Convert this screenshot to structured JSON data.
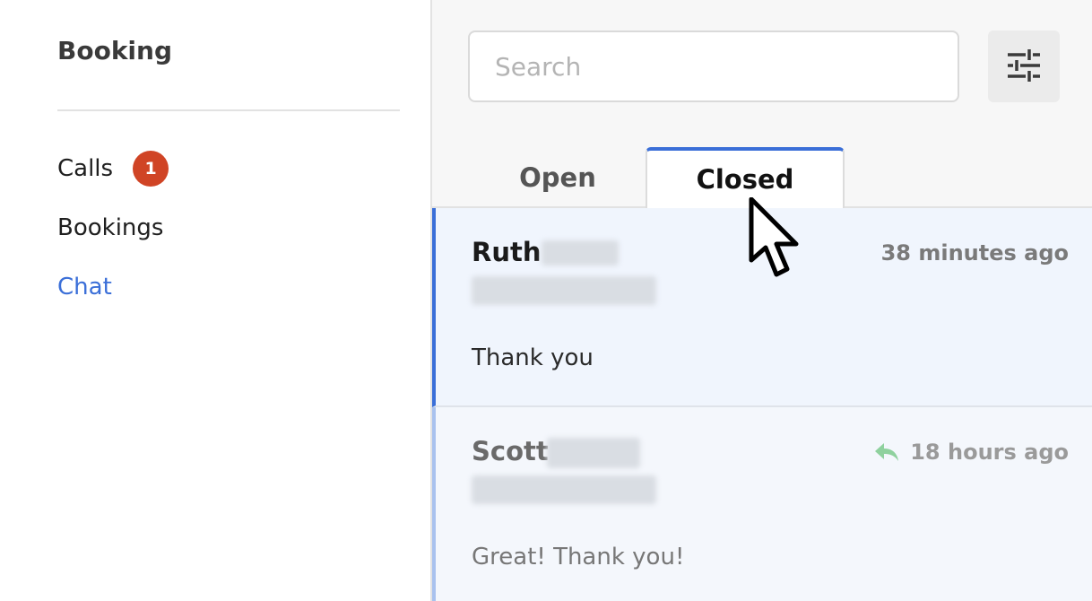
{
  "sidebar": {
    "title": "Booking",
    "items": [
      {
        "label": "Calls",
        "badge": "1",
        "active": false
      },
      {
        "label": "Bookings",
        "active": false
      },
      {
        "label": "Chat",
        "active": true
      }
    ]
  },
  "search": {
    "placeholder": "Search",
    "value": ""
  },
  "filter": {
    "icon": "sliders-icon"
  },
  "tabs": [
    {
      "label": "Open",
      "selected": false
    },
    {
      "label": "Closed",
      "selected": true
    }
  ],
  "conversations": [
    {
      "first_name": "Ruth",
      "time": "38 minutes ago",
      "message": "Thank you",
      "replied": false
    },
    {
      "first_name": "Scott",
      "time": "18 hours ago",
      "message": "Great! Thank you!",
      "replied": true
    }
  ],
  "colors": {
    "accent": "#3b6fd8",
    "badge": "#d04425",
    "reply_icon": "#8fd19e",
    "selected_row": "#f0f5fd"
  }
}
